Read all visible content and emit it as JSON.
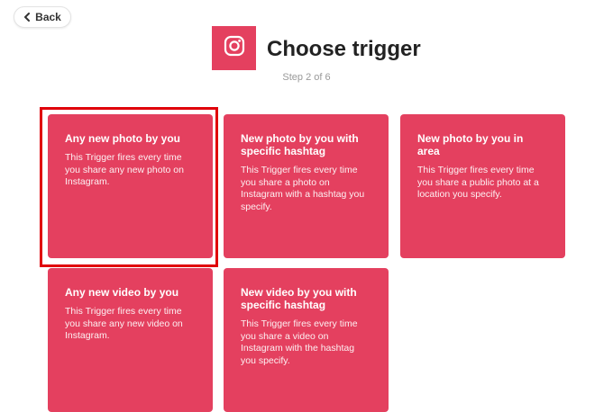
{
  "back": {
    "label": "Back"
  },
  "header": {
    "service_icon": "instagram-icon",
    "title": "Choose trigger",
    "step": "Step 2 of 6"
  },
  "colors": {
    "accent": "#e4405f",
    "highlight": "#e0000a"
  },
  "triggers": [
    {
      "title": "Any new photo by you",
      "description": "This Trigger fires every time you share any new photo on Instagram."
    },
    {
      "title": "New photo by you with specific hashtag",
      "description": "This Trigger fires every time you share a photo on Instagram with a hashtag you specify."
    },
    {
      "title": "New photo by you in area",
      "description": "This Trigger fires every time you share a public photo at a location you specify."
    },
    {
      "title": "Any new video by you",
      "description": "This Trigger fires every time you share any new video on Instagram."
    },
    {
      "title": "New video by you with specific hashtag",
      "description": "This Trigger fires every time you share a video on Instagram with the hashtag you specify."
    }
  ]
}
